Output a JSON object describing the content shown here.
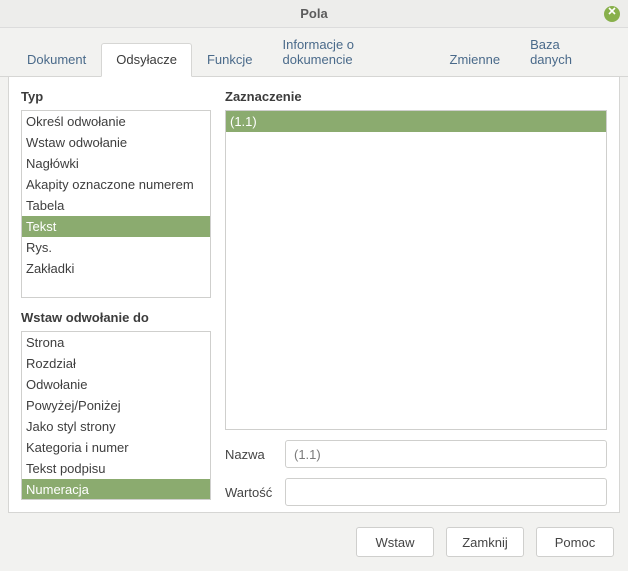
{
  "window": {
    "title": "Pola"
  },
  "tabs": [
    {
      "label": "Dokument"
    },
    {
      "label": "Odsyłacze"
    },
    {
      "label": "Funkcje"
    },
    {
      "label": "Informacje o dokumencie"
    },
    {
      "label": "Zmienne"
    },
    {
      "label": "Baza danych"
    }
  ],
  "active_tab": 1,
  "labels": {
    "typ": "Typ",
    "selection": "Zaznaczenie",
    "insert_ref": "Wstaw odwołanie do",
    "name": "Nazwa",
    "value": "Wartość"
  },
  "typ_items": [
    "Określ odwołanie",
    "Wstaw odwołanie",
    "Nagłówki",
    "Akapity oznaczone numerem",
    "Tabela",
    "Tekst",
    "Rys.",
    "Zakładki"
  ],
  "typ_selected": 5,
  "ref_items": [
    "Strona",
    "Rozdział",
    "Odwołanie",
    "Powyżej/Poniżej",
    "Jako styl strony",
    "Kategoria i numer",
    "Tekst podpisu",
    "Numeracja"
  ],
  "ref_selected": 7,
  "selection_items": [
    "(1.1)"
  ],
  "selection_selected": 0,
  "form": {
    "name_value": "(1.1)",
    "value_value": ""
  },
  "buttons": {
    "insert": "Wstaw",
    "close": "Zamknij",
    "help": "Pomoc"
  }
}
